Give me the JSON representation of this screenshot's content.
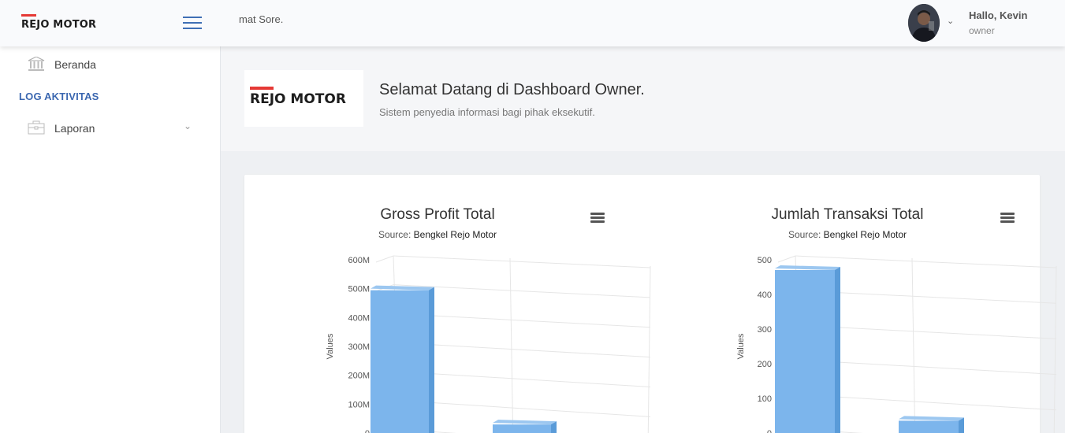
{
  "header": {
    "brand": "REJO MOTOR",
    "ticker": "mat Sore.",
    "greeting": "Hallo, Kevin",
    "role": "owner"
  },
  "sidebar": {
    "items": [
      {
        "label": "Beranda",
        "icon": "bank-icon"
      },
      {
        "label": "Laporan",
        "icon": "briefcase-icon"
      }
    ],
    "section_title": "LOG AKTIVITAS"
  },
  "welcome": {
    "logo_text": "REJO MOTOR",
    "title": "Selamat Datang di Dashboard Owner.",
    "subtitle": "Sistem penyedia informasi bagi pihak eksekutif."
  },
  "colors": {
    "accent": "#3b67b0",
    "brand_red": "#e53935",
    "bar_fill": "#7cb5ec"
  },
  "chart_data": [
    {
      "type": "bar",
      "title": "Gross Profit Total",
      "source_label": "Source:",
      "source": "Bengkel Rejo Motor",
      "ylabel": "Values",
      "yticks": [
        "0",
        "100M",
        "200M",
        "300M",
        "400M",
        "500M",
        "600M"
      ],
      "ylim": [
        0,
        600000000
      ],
      "series": [
        {
          "values": [
            500000000,
            35000000
          ]
        }
      ],
      "three_d": true
    },
    {
      "type": "bar",
      "title": "Jumlah Transaksi Total",
      "source_label": "Source:",
      "source": "Bengkel Rejo Motor",
      "ylabel": "Values",
      "yticks": [
        "0",
        "100",
        "200",
        "300",
        "400",
        "500"
      ],
      "ylim": [
        0,
        500
      ],
      "series": [
        {
          "values": [
            475,
            40
          ]
        }
      ],
      "three_d": true
    }
  ]
}
